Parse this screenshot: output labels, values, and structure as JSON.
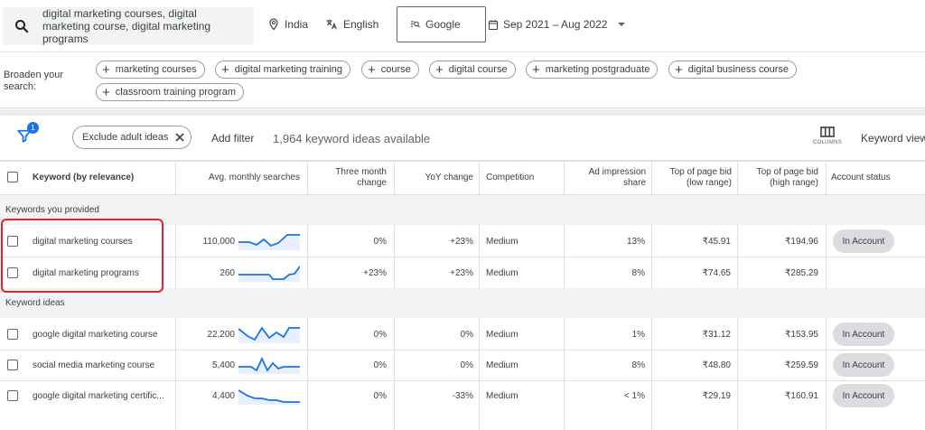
{
  "topbar": {
    "search_text": "digital marketing courses, digital marketing course, digital marketing programs",
    "location": "India",
    "language": "English",
    "engine": "Google",
    "date_range": "Sep 2021 – Aug 2022"
  },
  "broaden": {
    "label": "Broaden your search:",
    "chips": [
      "marketing courses",
      "digital marketing training",
      "course",
      "digital course",
      "marketing postgraduate",
      "digital business course",
      "classroom training program"
    ]
  },
  "filter": {
    "badge": "1",
    "exclude_chip": "Exclude adult ideas",
    "add_filter": "Add filter",
    "count": "1,964 keyword ideas available",
    "columns_label": "COLUMNS",
    "keyword_view": "Keyword view"
  },
  "table": {
    "headers": {
      "keyword": "Keyword (by relevance)",
      "avg": "Avg. monthly searches",
      "three_month_1": "Three month",
      "three_month_2": "change",
      "yoy": "YoY change",
      "competition": "Competition",
      "impression_1": "Ad impression",
      "impression_2": "share",
      "low_1": "Top of page bid",
      "low_2": "(low range)",
      "high_1": "Top of page bid",
      "high_2": "(high range)",
      "status": "Account status"
    },
    "group_provided": "Keywords you provided",
    "group_ideas": "Keyword ideas",
    "provided_rows": [
      {
        "keyword": "digital marketing courses",
        "avg": "110,000",
        "three": "0%",
        "yoy": "+23%",
        "competition": "Medium",
        "impression": "13%",
        "low": "₹45.91",
        "high": "₹194.96",
        "status": "In Account"
      },
      {
        "keyword": "digital marketing programs",
        "avg": "260",
        "three": "+23%",
        "yoy": "+23%",
        "competition": "Medium",
        "impression": "8%",
        "low": "₹74.65",
        "high": "₹285.29",
        "status": ""
      }
    ],
    "idea_rows": [
      {
        "keyword": "google digital marketing course",
        "avg": "22,200",
        "three": "0%",
        "yoy": "0%",
        "competition": "Medium",
        "impression": "1%",
        "low": "₹31.12",
        "high": "₹153.95",
        "status": "In Account"
      },
      {
        "keyword": "social media marketing course",
        "avg": "5,400",
        "three": "0%",
        "yoy": "0%",
        "competition": "Medium",
        "impression": "8%",
        "low": "₹48.80",
        "high": "₹259.59",
        "status": "In Account"
      },
      {
        "keyword": "google digital marketing certific...",
        "avg": "4,400",
        "three": "0%",
        "yoy": "-33%",
        "competition": "Medium",
        "impression": "< 1%",
        "low": "₹29.19",
        "high": "₹160.91",
        "status": "In Account"
      }
    ]
  },
  "colors": {
    "accent": "#1a73e8",
    "highlight": "#e8212b",
    "pill": "#dadce0",
    "group_bg": "#f1f3f4"
  }
}
